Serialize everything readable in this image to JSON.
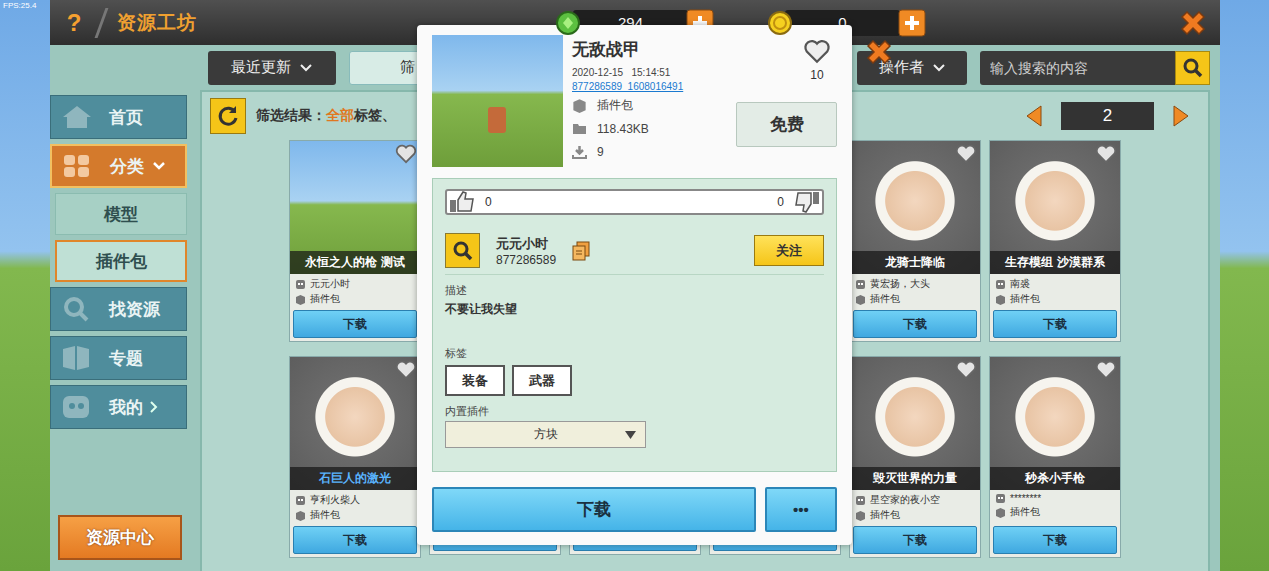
{
  "fps": "FPS:25.4",
  "header": {
    "help": "?",
    "title": "资源工坊",
    "gems": "294",
    "coins": "0"
  },
  "toolbar": {
    "sort": "最近更新",
    "filter": "筛",
    "author_filter": "操作者",
    "search": {
      "placeholder": "输入搜索的内容"
    }
  },
  "sidebar": {
    "items": [
      {
        "label": "首页",
        "kind": "main",
        "selected": false
      },
      {
        "label": "分类",
        "kind": "main",
        "selected": true,
        "expanded": true
      },
      {
        "label": "模型",
        "kind": "sub",
        "selected": false
      },
      {
        "label": "插件包",
        "kind": "sub",
        "selected": true
      },
      {
        "label": "找资源",
        "kind": "main",
        "selected": false
      },
      {
        "label": "专题",
        "kind": "main",
        "selected": false
      },
      {
        "label": "我的",
        "kind": "main",
        "selected": false,
        "expanded": false
      }
    ],
    "resource_center": "资源中心"
  },
  "filter": {
    "label": "筛选结果：",
    "all": "全部",
    "rest": "标签、",
    "page": "2"
  },
  "cards": [
    [
      {
        "title": "永恒之人的枪 测试",
        "author": "元元小时",
        "type": "插件包",
        "button": "下载",
        "kind": "screenshot",
        "color": "#ffffff"
      },
      {
        "title": "龙骑士降临",
        "author": "黄宏扬，大头",
        "type": "插件包",
        "button": "下载",
        "kind": "avatar",
        "color": "#ffffff"
      },
      {
        "title": "生存模组 沙漠群系",
        "author": "南裘",
        "type": "插件包",
        "button": "下载",
        "kind": "avatar",
        "color": "#ffffff"
      }
    ],
    [
      {
        "title": "石巨人的激光",
        "author": "亨利火柴人",
        "type": "插件包",
        "button": "下载",
        "kind": "avatar",
        "color": "#5ab4ff"
      },
      {
        "title": "毁灭世界的力量",
        "author": "星空家的夜小空",
        "type": "插件包",
        "button": "下载",
        "kind": "avatar",
        "color": "#ffffff"
      },
      {
        "title": "秒杀小手枪",
        "author": "********",
        "type": "插件包",
        "button": "下载",
        "kind": "avatar",
        "color": "#ffffff"
      }
    ]
  ],
  "modal": {
    "title": "无敌战甲",
    "date": "2020-12-15   15:14:51",
    "id": "877286589_1608016491",
    "type": "插件包",
    "size": "118.43KB",
    "downloads": "9",
    "favorites": "10",
    "price": "免费",
    "up_votes": "0",
    "down_votes": "0",
    "author": {
      "name": "元元小时",
      "id": "877286589",
      "follow": "关注"
    },
    "description_label": "描述",
    "description": "不要让我失望",
    "tags_label": "标签",
    "tags": [
      "装备",
      "武器"
    ],
    "plugin_label": "内置插件",
    "plugin": "方块",
    "download": "下载",
    "more": "•••"
  }
}
